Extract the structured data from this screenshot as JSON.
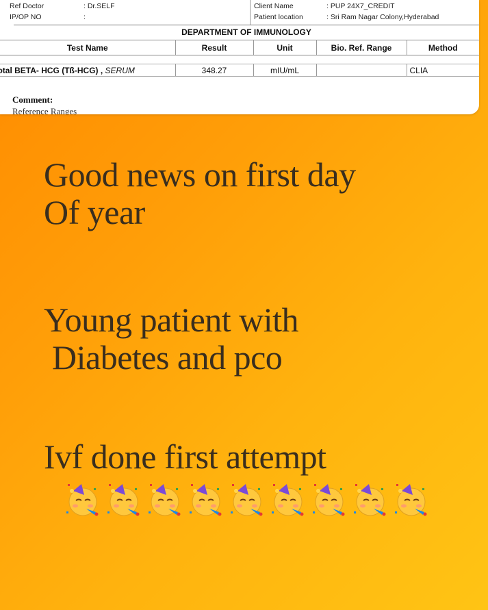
{
  "report": {
    "ref_doctor_label": "Ref Doctor",
    "ref_doctor_value": ": Dr.SELF",
    "ip_op_label": "IP/OP NO",
    "ip_op_value": ":",
    "client_name_label": "Client Name",
    "client_name_value": ": PUP 24X7_CREDIT",
    "patient_location_label": "Patient location",
    "patient_location_value": ": Sri Ram Nagar Colony,Hyderabad",
    "department": "DEPARTMENT OF IMMUNOLOGY",
    "columns": [
      "Test Name",
      "Result",
      "Unit",
      "Bio. Ref. Range",
      "Method"
    ],
    "row": {
      "test_name": "Total BETA- HCG (Tß-HCG) ,",
      "specimen": "SERUM",
      "result": "348.27",
      "unit": "mIU/mL",
      "ref_range": "",
      "method": "CLIA"
    },
    "comment_label": "Comment:",
    "reference_ranges_label": "Reference Ranges"
  },
  "story": {
    "line1": "Good news on first day\nOf year",
    "line2": "Young patient with\n Diabetes and pco",
    "line3": "Ivf done first attempt"
  },
  "emojis": {
    "icon": "partying-face-emoji",
    "count": 9,
    "colors": {
      "face": "#ffc83d",
      "hat": "#7b4bd6",
      "horn": "#1e88e5"
    }
  }
}
